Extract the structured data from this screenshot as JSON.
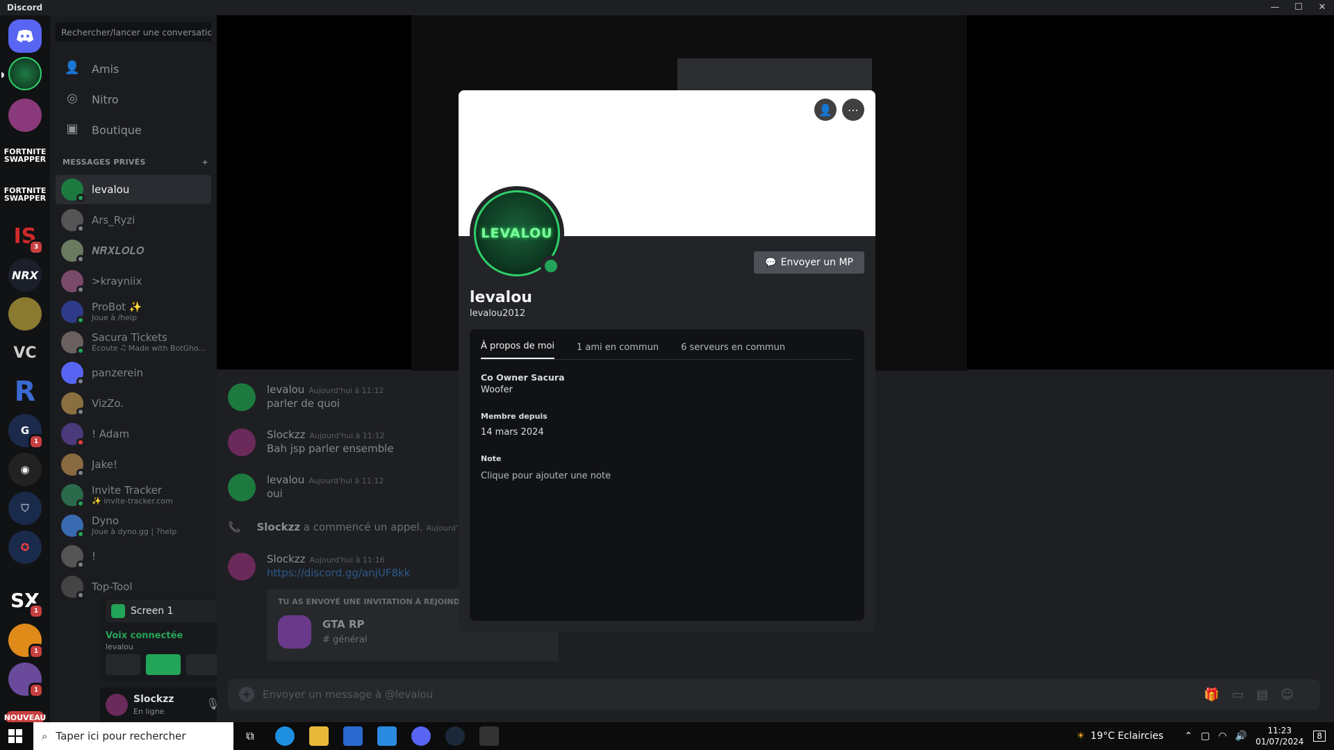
{
  "window": {
    "title": "Discord",
    "controls": [
      "—",
      "☐",
      "✕"
    ]
  },
  "sidebar": {
    "search_placeholder": "Rechercher/lancer une conversation",
    "nav": [
      {
        "label": "Amis",
        "icon": "friends-icon"
      },
      {
        "label": "Nitro",
        "icon": "nitro-icon"
      },
      {
        "label": "Boutique",
        "icon": "shop-icon"
      }
    ],
    "dm_header": "MESSAGES PRIVÉS",
    "dms": [
      {
        "name": "levalou",
        "sub": "",
        "status": "online",
        "color": "#1d7a3f"
      },
      {
        "name": "Ars_Ryzi",
        "sub": "",
        "status": "offline",
        "color": "#555"
      },
      {
        "name": "𝑵𝑹𝑿𝑳𝑶𝑳𝑶",
        "sub": "",
        "status": "offline",
        "color": "#6a7a60"
      },
      {
        "name": ">krayniix",
        "sub": "",
        "status": "offline",
        "color": "#7a4a6a"
      },
      {
        "name": "ProBot ✨",
        "sub": "Joue à /help",
        "status": "online",
        "color": "#2f3b8a"
      },
      {
        "name": "Sacura Tickets",
        "sub": "Écoute 🎝 Made with BotGho...",
        "status": "online",
        "color": "#6a6060"
      },
      {
        "name": "panzerein",
        "sub": "",
        "status": "offline",
        "color": "#5865f2"
      },
      {
        "name": "VizZo.",
        "sub": "",
        "status": "offline",
        "color": "#8a7040"
      },
      {
        "name": "! Adam",
        "sub": "",
        "status": "dnd",
        "color": "#4a3a7a"
      },
      {
        "name": "Jake!",
        "sub": "",
        "status": "offline",
        "color": "#8a6a40"
      },
      {
        "name": "Invite Tracker",
        "sub": "✨ invite-tracker.com",
        "status": "online",
        "color": "#2a6a4a"
      },
      {
        "name": "Dyno",
        "sub": "Joue à dyno.gg | ?help",
        "status": "online",
        "color": "#3a6ab0"
      },
      {
        "name": "!",
        "sub": "",
        "status": "offline",
        "color": "#555"
      },
      {
        "name": "Top-Tool",
        "sub": "",
        "status": "offline",
        "color": "#444"
      }
    ],
    "voice": {
      "channel": "Screen 1",
      "status": "Voix connectée",
      "user": "levalou"
    },
    "user": {
      "name": "Slockzz",
      "status": "En ligne"
    }
  },
  "rail": {
    "new_label": "NOUVEAU",
    "texts": [
      "FORTNITE SWAPPER",
      "FORTNITE SWAPPER"
    ],
    "badges": [
      "3",
      "1",
      "1",
      "1",
      "1"
    ]
  },
  "chat": {
    "messages": [
      {
        "author": "levalou",
        "time": "Aujourd'hui à 11:12",
        "text": "parler de quoi",
        "color": "#1d7a3f"
      },
      {
        "author": "Slockzz",
        "time": "Aujourd'hui à 11:12",
        "text": "Bah jsp parler ensemble",
        "color": "#6a2a5a"
      },
      {
        "author": "levalou",
        "time": "Aujourd'hui à 11:12",
        "text": "oui",
        "color": "#1d7a3f"
      },
      {
        "author": "Slockzz",
        "time": "Aujourd'hui à 11:16",
        "text": "https://discord.gg/anjUF8kk",
        "color": "#6a2a5a"
      }
    ],
    "call_text": "a commencé un appel.",
    "call_user": "Slockzz",
    "call_time": "Aujourd'hu",
    "invite_header": "TU AS ENVOYÉ UNE INVITATION À REJOINDRE",
    "invite_server": "GTA RP",
    "invite_channel": "général",
    "composer_placeholder": "Envoyer un message à @levalou"
  },
  "profile": {
    "display_name": "levalou",
    "username": "levalou2012",
    "avatar_text": "LEVALOU",
    "message_button": "Envoyer un MP",
    "tabs": [
      "À propos de moi",
      "1 ami en commun",
      "6 serveurs en commun"
    ],
    "about_title": "Co Owner Sacura",
    "about_text": "Woofer",
    "member_since_label": "Membre depuis",
    "member_since": "14 mars 2024",
    "note_label": "Note",
    "note_placeholder": "Clique pour ajouter une note",
    "status_color": "#23a559"
  },
  "taskbar": {
    "search": "Taper ici pour rechercher",
    "weather": "19°C Eclaircies",
    "time": "11:23",
    "date": "01/07/2024",
    "notif": "8"
  }
}
